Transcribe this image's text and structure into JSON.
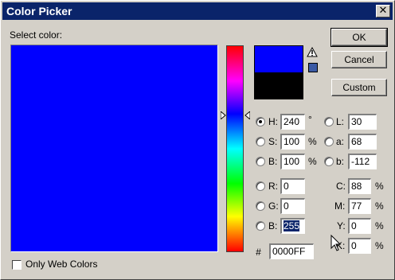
{
  "window": {
    "title": "Color Picker",
    "close_glyph": "✕"
  },
  "select_color_label": "Select color:",
  "colors": {
    "current": "#0000ff",
    "original": "#000000",
    "gamut_icon": "#3b5aa5"
  },
  "buttons": {
    "ok": "OK",
    "cancel": "Cancel",
    "custom": "Custom"
  },
  "hsb": {
    "h": {
      "label": "H:",
      "value": "240",
      "unit": "°"
    },
    "s": {
      "label": "S:",
      "value": "100",
      "unit": "%"
    },
    "b": {
      "label": "B:",
      "value": "100",
      "unit": "%"
    }
  },
  "lab": {
    "l": {
      "label": "L:",
      "value": "30"
    },
    "a": {
      "label": "a:",
      "value": "68"
    },
    "b": {
      "label": "b:",
      "value": "-112"
    }
  },
  "rgb": {
    "r": {
      "label": "R:",
      "value": "0"
    },
    "g": {
      "label": "G:",
      "value": "0"
    },
    "b": {
      "label": "B:",
      "value": "255"
    }
  },
  "cmyk": {
    "c": {
      "label": "C:",
      "value": "88",
      "unit": "%"
    },
    "m": {
      "label": "M:",
      "value": "77",
      "unit": "%"
    },
    "y": {
      "label": "Y:",
      "value": "0",
      "unit": "%"
    },
    "k": {
      "label": "K:",
      "value": "0",
      "unit": "%"
    }
  },
  "hex": {
    "label": "#",
    "value": "0000FF"
  },
  "web_colors": {
    "label": "Only Web Colors",
    "checked": false
  }
}
